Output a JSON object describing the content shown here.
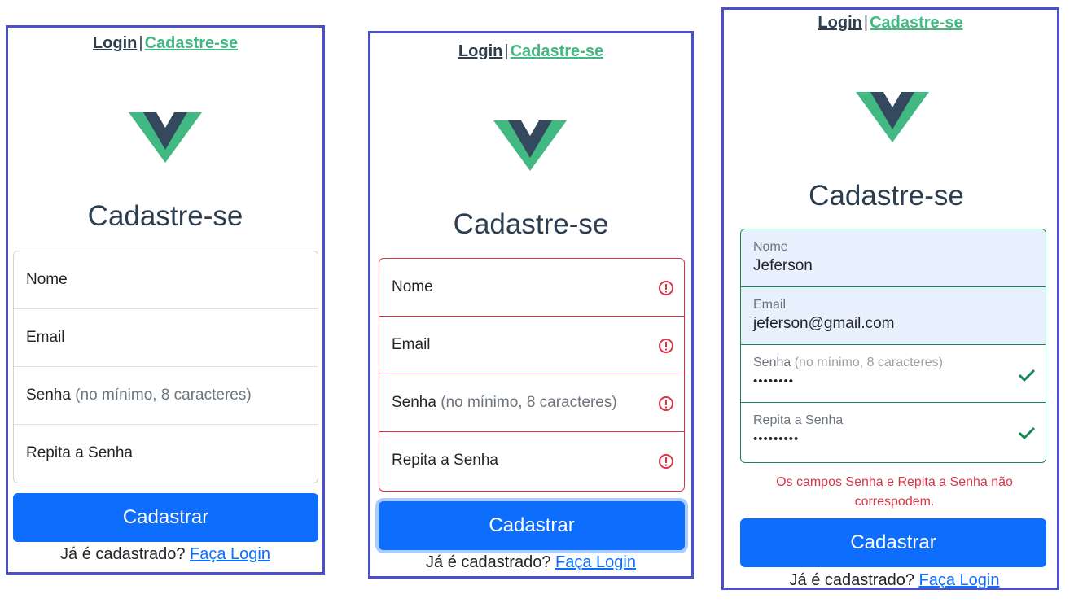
{
  "colors": {
    "frame": "#4a4fcc",
    "nav_login": "#2c3e50",
    "nav_signup": "#42b983",
    "logo_outer": "#42b983",
    "logo_inner": "#35495e",
    "primary": "#0d6efd",
    "danger": "#dc3545",
    "success": "#198754",
    "autofill_bg": "#e8f0fe"
  },
  "nav": {
    "login": "Login",
    "separator": "|",
    "signup": "Cadastre-se"
  },
  "logo_icon": "vue-logo",
  "form": {
    "title": "Cadastre-se",
    "name_label": "Nome",
    "email_label": "Email",
    "password_label": "Senha",
    "password_hint": "(no mínimo, 8 caracteres)",
    "repeat_label": "Repita a Senha",
    "submit": "Cadastrar",
    "footer_text": "Já é cadastrado?",
    "footer_link": "Faça Login"
  },
  "filled_state": {
    "name_value": "Jeferson",
    "email_value": "jeferson@gmail.com",
    "password_masked": "••••••••",
    "repeat_masked": "•••••••••",
    "error_line1": "Os campos Senha e Repita a Senha não",
    "error_line2": "correspodem."
  },
  "icons": {
    "invalid": "exclamation-circle-icon",
    "valid": "check-icon"
  }
}
